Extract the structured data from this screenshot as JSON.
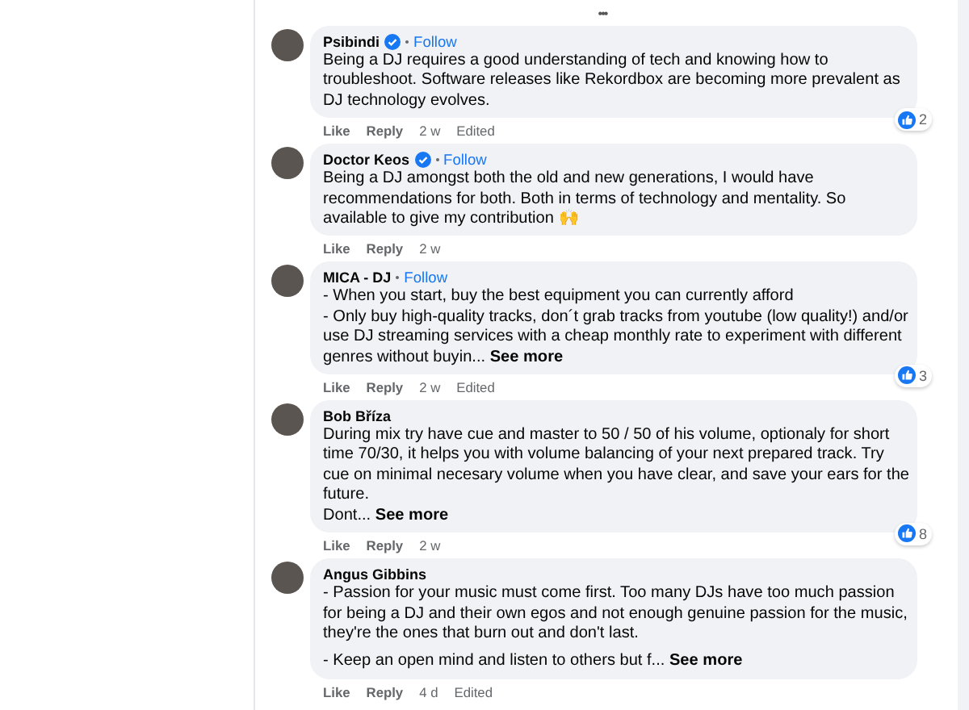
{
  "more_label": "•••",
  "comments": [
    {
      "name": "Psibindi",
      "verified": true,
      "follow": "Follow",
      "paragraphs": [
        [
          "Being a DJ requires a good understanding of tech and knowing how to troubleshoot. Software releases like Rekordbox are becoming more prevalent as DJ technology evolves."
        ]
      ],
      "actions": [
        "Like",
        "Reply"
      ],
      "time": "2 w",
      "edited": "Edited",
      "reactions": "2"
    },
    {
      "name": "Doctor Keos",
      "verified": true,
      "follow": "Follow",
      "paragraphs": [
        [
          "Being a DJ amongst both the old and new generations, I would have recommendations for both. Both in terms of technology and mentality. So available to give my contribution 🙌"
        ]
      ],
      "actions": [
        "Like",
        "Reply"
      ],
      "time": "2 w"
    },
    {
      "name": "MICA - DJ",
      "verified": false,
      "follow": "Follow",
      "paragraphs": [
        [
          "- When you start, buy the best equipment you can currently afford",
          "- Only buy high-quality tracks, don´t grab tracks from youtube (low quality!) and/or use DJ streaming services with a cheap monthly rate to experiment with different genres without buyin..."
        ]
      ],
      "see_more": "See more",
      "actions": [
        "Like",
        "Reply"
      ],
      "time": "2 w",
      "edited": "Edited",
      "reactions": "3"
    },
    {
      "name": "Bob Bříza",
      "verified": false,
      "paragraphs": [
        [
          "During mix try have cue and master to 50 / 50 of his volume, optionaly for short time 70/30, it helps you with volume balancing of your next prepared track. Try cue on minimal necesary volume when you have clear, and save your ears for the future.",
          "Dont..."
        ]
      ],
      "see_more": "See more",
      "actions": [
        "Like",
        "Reply"
      ],
      "time": "2 w",
      "reactions": "8"
    },
    {
      "name": "Angus Gibbins",
      "verified": false,
      "paragraphs": [
        [
          "- Passion for your music must come first. Too many DJs have too much passion for being a DJ and their own egos and not enough genuine passion for the music, they're the ones that burn out and don't last."
        ],
        [
          "- Keep an open mind and listen to others but f..."
        ]
      ],
      "see_more": "See more",
      "actions": [
        "Like",
        "Reply"
      ],
      "time": "4 d",
      "edited": "Edited"
    }
  ]
}
